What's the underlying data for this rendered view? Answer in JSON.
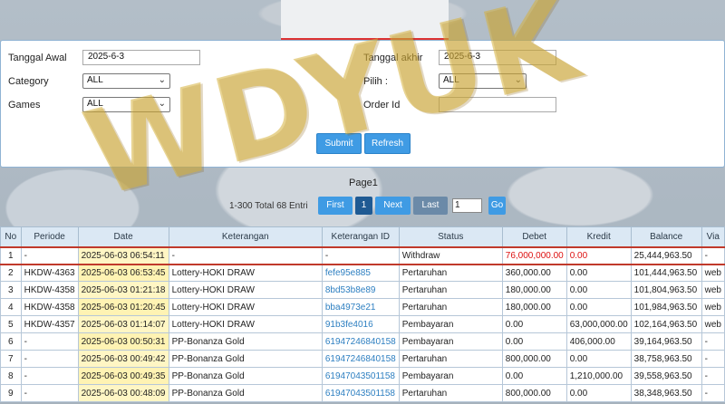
{
  "form": {
    "tanggal_awal_label": "Tanggal Awal",
    "tanggal_awal_value": "2025-6-3",
    "tanggal_akhir_label": "Tanggal akhir",
    "tanggal_akhir_value": "2025-6-3",
    "category_label": "Category",
    "category_value": "ALL",
    "pilih_label": "Pilih  :",
    "pilih_value": "ALL",
    "games_label": "Games",
    "games_value": "ALL",
    "order_id_label": "Order Id",
    "order_id_value": "",
    "submit_label": "Submit",
    "refresh_label": "Refresh"
  },
  "pager": {
    "title": "Page1",
    "info": "1-300 Total 68 Entri",
    "first": "First",
    "current": "1",
    "next": "Next",
    "last": "Last",
    "goto_value": "1",
    "go": "Go"
  },
  "table": {
    "headers": [
      "No",
      "Periode",
      "Date",
      "Keterangan",
      "Keterangan ID",
      "Status",
      "Debet",
      "Kredit",
      "Balance",
      "Via"
    ],
    "rows": [
      [
        "1",
        "-",
        "2025-06-03 06:54:11",
        "-",
        "-",
        "Withdraw",
        "76,000,000.00",
        "0.00",
        "25,444,963.50",
        "-"
      ],
      [
        "2",
        "HKDW-4363",
        "2025-06-03 06:53:45",
        "Lottery-HOKI DRAW",
        "fefe95e885",
        "Pertaruhan",
        "360,000.00",
        "0.00",
        "101,444,963.50",
        "web"
      ],
      [
        "3",
        "HKDW-4358",
        "2025-06-03 01:21:18",
        "Lottery-HOKI DRAW",
        "8bd53b8e89",
        "Pertaruhan",
        "180,000.00",
        "0.00",
        "101,804,963.50",
        "web"
      ],
      [
        "4",
        "HKDW-4358",
        "2025-06-03 01:20:45",
        "Lottery-HOKI DRAW",
        "bba4973e21",
        "Pertaruhan",
        "180,000.00",
        "0.00",
        "101,984,963.50",
        "web"
      ],
      [
        "5",
        "HKDW-4357",
        "2025-06-03 01:14:07",
        "Lottery-HOKI DRAW",
        "91b3fe4016",
        "Pembayaran",
        "0.00",
        "63,000,000.00",
        "102,164,963.50",
        "web"
      ],
      [
        "6",
        "-",
        "2025-06-03 00:50:31",
        "PP-Bonanza Gold",
        "61947246840158",
        "Pembayaran",
        "0.00",
        "406,000.00",
        "39,164,963.50",
        "-"
      ],
      [
        "7",
        "-",
        "2025-06-03 00:49:42",
        "PP-Bonanza Gold",
        "61947246840158",
        "Pertaruhan",
        "800,000.00",
        "0.00",
        "38,758,963.50",
        "-"
      ],
      [
        "8",
        "-",
        "2025-06-03 00:49:35",
        "PP-Bonanza Gold",
        "61947043501158",
        "Pembayaran",
        "0.00",
        "1,210,000.00",
        "39,558,963.50",
        "-"
      ],
      [
        "9",
        "-",
        "2025-06-03 00:48:09",
        "PP-Bonanza Gold",
        "61947043501158",
        "Pertaruhan",
        "800,000.00",
        "0.00",
        "38,348,963.50",
        "-"
      ]
    ]
  },
  "watermark": "WDYUK",
  "colors": {
    "accent": "#3f9be4",
    "highlight_border": "#c0392b",
    "debit_red": "#dd1111",
    "link": "#2d7fc1"
  }
}
